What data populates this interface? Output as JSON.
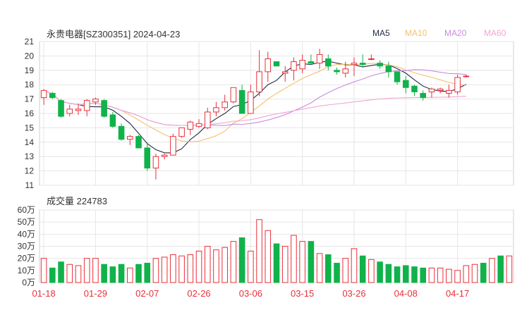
{
  "header": {
    "title": "永贵电器[SZ300351] 2024-04-23",
    "volume_title": "成交量 224783"
  },
  "legend": [
    {
      "name": "MA5",
      "color": "#1f2a44"
    },
    {
      "name": "MA10",
      "color": "#f5c06a"
    },
    {
      "name": "MA20",
      "color": "#c98be0"
    },
    {
      "name": "MA60",
      "color": "#f0a6d2"
    }
  ],
  "colors": {
    "up": "#e8303a",
    "down": "#10b24a",
    "grid": "#e6e6e6",
    "axis_text": "#333333",
    "date_text": "#e8303a"
  },
  "chart_data": [
    {
      "type": "candlestick",
      "title": "永贵电器[SZ300351] 2024-04-23",
      "ylim": [
        11,
        21
      ],
      "yticks": [
        11,
        12,
        13,
        14,
        15,
        16,
        17,
        18,
        19,
        20,
        21
      ],
      "x_ticks": [
        {
          "index": 0,
          "label": "01-18"
        },
        {
          "index": 6,
          "label": "01-29"
        },
        {
          "index": 12,
          "label": "02-07"
        },
        {
          "index": 18,
          "label": "02-26"
        },
        {
          "index": 24,
          "label": "03-06"
        },
        {
          "index": 30,
          "label": "03-15"
        },
        {
          "index": 36,
          "label": "03-26"
        },
        {
          "index": 42,
          "label": "04-08"
        },
        {
          "index": 48,
          "label": "04-17"
        }
      ],
      "ohlc": [
        [
          17.1,
          17.7,
          16.6,
          17.6
        ],
        [
          17.4,
          17.5,
          17.0,
          17.1
        ],
        [
          16.9,
          17.0,
          15.7,
          15.8
        ],
        [
          16.0,
          16.6,
          15.8,
          16.3
        ],
        [
          16.2,
          16.7,
          15.9,
          16.3
        ],
        [
          16.2,
          17.0,
          15.8,
          16.9
        ],
        [
          16.8,
          17.1,
          16.6,
          17.0
        ],
        [
          16.9,
          17.0,
          15.7,
          15.8
        ],
        [
          15.9,
          16.1,
          15.0,
          15.1
        ],
        [
          15.1,
          15.3,
          14.1,
          14.2
        ],
        [
          14.2,
          14.5,
          13.8,
          14.4
        ],
        [
          14.4,
          14.5,
          13.6,
          13.6
        ],
        [
          13.6,
          14.0,
          12.0,
          12.2
        ],
        [
          12.2,
          13.2,
          11.4,
          13.0
        ],
        [
          13.0,
          13.2,
          12.8,
          13.1
        ],
        [
          13.1,
          14.6,
          13.1,
          14.4
        ],
        [
          14.4,
          15.0,
          14.3,
          15.0
        ],
        [
          14.9,
          15.5,
          14.5,
          15.4
        ],
        [
          15.1,
          15.6,
          15.0,
          15.3
        ],
        [
          15.0,
          16.4,
          14.9,
          16.1
        ],
        [
          16.1,
          16.8,
          15.8,
          16.4
        ],
        [
          16.4,
          17.3,
          16.2,
          16.8
        ],
        [
          16.8,
          17.4,
          16.7,
          17.8
        ],
        [
          17.6,
          18.0,
          16.0,
          16.0
        ],
        [
          16.0,
          18.0,
          16.0,
          17.5
        ],
        [
          17.5,
          20.4,
          17.2,
          18.9
        ],
        [
          18.9,
          20.3,
          18.2,
          19.8
        ],
        [
          19.6,
          19.6,
          19.3,
          19.3
        ],
        [
          18.8,
          19.3,
          18.2,
          18.9
        ],
        [
          19.0,
          19.9,
          18.3,
          19.6
        ],
        [
          19.1,
          20.1,
          18.8,
          19.7
        ],
        [
          19.6,
          20.1,
          19.4,
          19.5
        ],
        [
          19.5,
          20.5,
          19.1,
          20.1
        ],
        [
          19.8,
          20.1,
          19.0,
          19.3
        ],
        [
          19.0,
          19.2,
          18.7,
          18.9
        ],
        [
          18.8,
          19.6,
          18.5,
          19.1
        ],
        [
          19.4,
          19.9,
          18.6,
          19.5
        ],
        [
          19.5,
          20.1,
          19.2,
          19.4
        ],
        [
          19.8,
          20.1,
          19.7,
          19.8
        ],
        [
          19.5,
          19.7,
          19.1,
          19.3
        ],
        [
          19.3,
          19.6,
          18.5,
          18.9
        ],
        [
          18.9,
          18.9,
          18.0,
          18.2
        ],
        [
          18.3,
          18.6,
          17.4,
          17.8
        ],
        [
          17.9,
          18.0,
          17.2,
          17.5
        ],
        [
          17.4,
          17.6,
          16.9,
          17.1
        ],
        [
          17.5,
          17.8,
          17.1,
          17.7
        ],
        [
          17.6,
          17.8,
          17.4,
          17.7
        ],
        [
          17.4,
          18.0,
          17.1,
          17.6
        ],
        [
          17.5,
          18.7,
          17.3,
          18.5
        ],
        [
          18.6,
          18.7,
          18.5,
          18.6
        ]
      ]
    },
    {
      "type": "bar",
      "title": "成交量 224783",
      "ylim": [
        0,
        60
      ],
      "yticks": [
        {
          "value": 0,
          "label": "0万"
        },
        {
          "value": 10,
          "label": "10万"
        },
        {
          "value": 20,
          "label": "20万"
        },
        {
          "value": 30,
          "label": "30万"
        },
        {
          "value": 40,
          "label": "40万"
        },
        {
          "value": 50,
          "label": "50万"
        },
        {
          "value": 60,
          "label": "60万"
        }
      ],
      "values": [
        20,
        12,
        17,
        15,
        14,
        20,
        20,
        15,
        13,
        15,
        12,
        15,
        16,
        20,
        21,
        23,
        22,
        23,
        26,
        30,
        27,
        29,
        34,
        37,
        26,
        52,
        43,
        32,
        30,
        39,
        34,
        34,
        24,
        23,
        16,
        20,
        28,
        22,
        19,
        17,
        15,
        13,
        14,
        13,
        12,
        12,
        12,
        11,
        10,
        14,
        15,
        16,
        20,
        22,
        22
      ]
    }
  ]
}
